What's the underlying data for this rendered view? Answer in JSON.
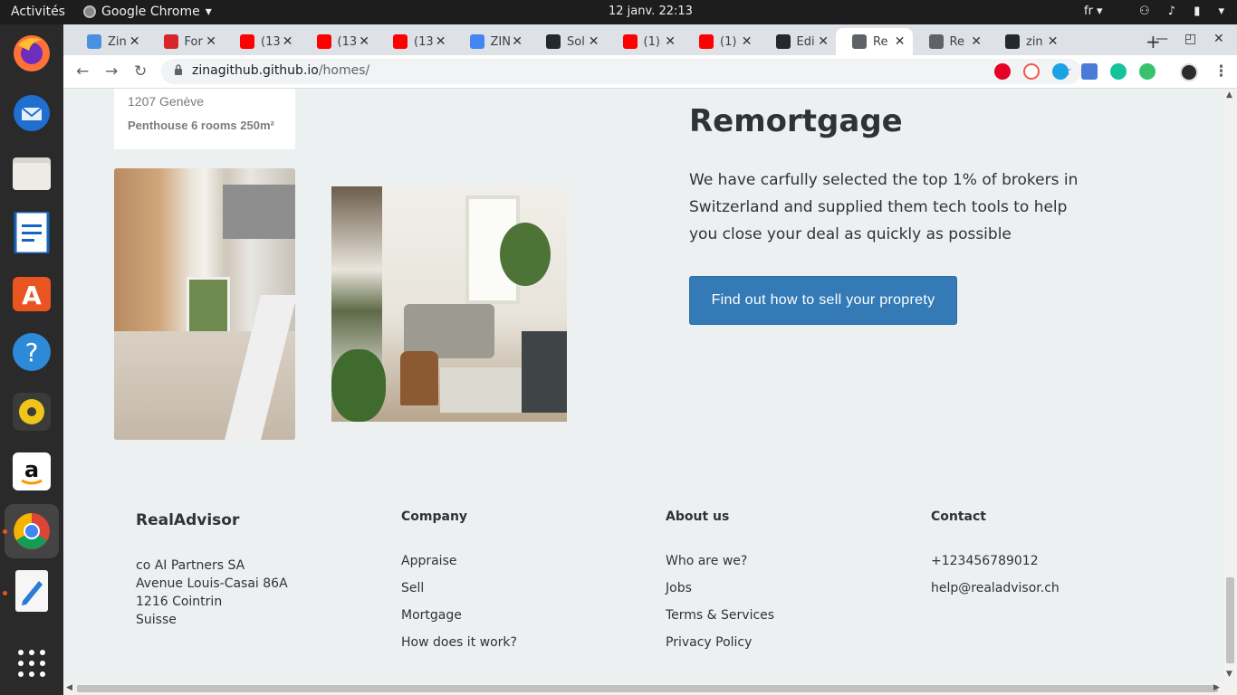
{
  "system": {
    "activities": "Activités",
    "app_name": "Google Chrome",
    "clock": "12 janv.  22:13",
    "lang": "fr"
  },
  "tabs": [
    {
      "title": "Zin",
      "color": "#4a90e2"
    },
    {
      "title": "For",
      "color": "#d6262c"
    },
    {
      "title": "(13",
      "color": "#ff0000"
    },
    {
      "title": "(13",
      "color": "#ff0000"
    },
    {
      "title": "(13",
      "color": "#ff0000"
    },
    {
      "title": "ZIN",
      "color": "#4285f4"
    },
    {
      "title": "Sol",
      "color": "#24292e"
    },
    {
      "title": "(1)",
      "color": "#ff0000"
    },
    {
      "title": "(1)",
      "color": "#ff0000"
    },
    {
      "title": "Edi",
      "color": "#24292e"
    },
    {
      "title": "Re",
      "color": "#5f6368",
      "active": true
    },
    {
      "title": "Re",
      "color": "#5f6368"
    },
    {
      "title": "zin",
      "color": "#24292e"
    }
  ],
  "address_bar": {
    "host": "zinagithub.github.io",
    "path": "/homes/"
  },
  "listing": {
    "address": "1207 Genève",
    "description": "Penthouse 6 rooms 250m²"
  },
  "section": {
    "title": "Remortgage",
    "body": "We have carfully selected the top 1% of brokers in Switzerland and supplied them tech tools to help you close your deal as quickly as possible",
    "cta": "Find out how to sell your proprety"
  },
  "footer": {
    "brand": "RealAdvisor",
    "address": [
      "co AI Partners SA",
      "Avenue Louis-Casai 86A",
      "1216 Cointrin",
      "Suisse"
    ],
    "columns": [
      {
        "heading": "Company",
        "links": [
          "Appraise",
          "Sell",
          "Mortgage",
          "How does it work?"
        ]
      },
      {
        "heading": "About us",
        "links": [
          "Who are we?",
          "Jobs",
          "Terms & Services",
          "Privacy Policy"
        ]
      },
      {
        "heading": "Contact",
        "links": [
          "+123456789012",
          "help@realadvisor.ch"
        ]
      }
    ]
  },
  "colors": {
    "accent": "#337ab7",
    "page_bg": "#ecf0f1",
    "text": "#2e3336"
  }
}
